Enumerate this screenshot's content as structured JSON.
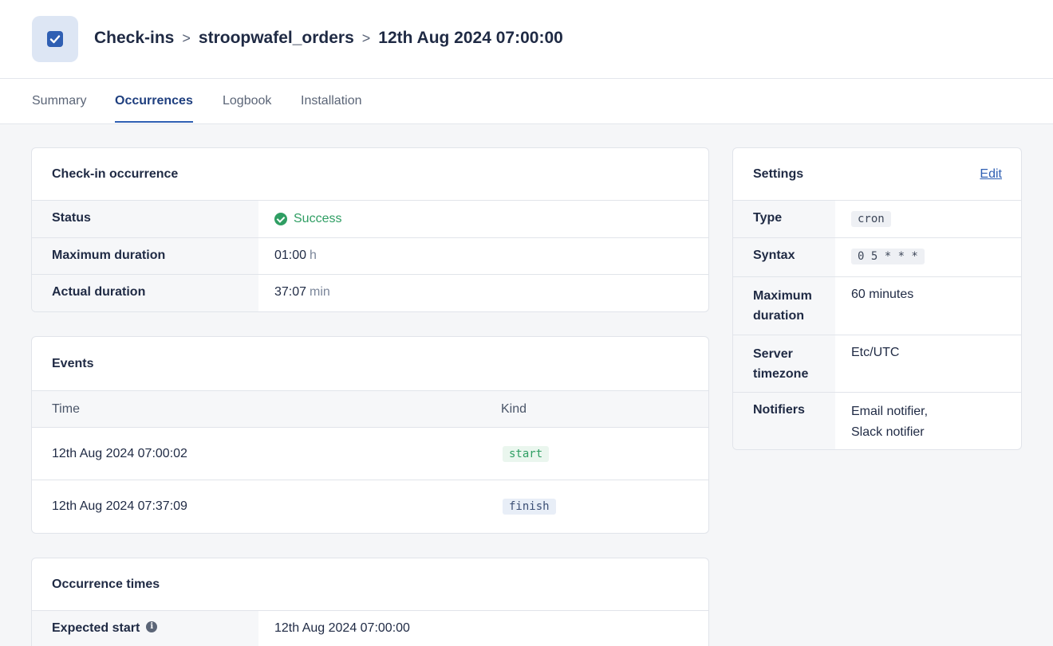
{
  "breadcrumb": {
    "items": [
      "Check-ins",
      "stroopwafel_orders",
      "12th Aug 2024 07:00:00"
    ],
    "separator": ">"
  },
  "tabs": [
    {
      "label": "Summary",
      "active": false
    },
    {
      "label": "Occurrences",
      "active": true
    },
    {
      "label": "Logbook",
      "active": false
    },
    {
      "label": "Installation",
      "active": false
    }
  ],
  "occurrence": {
    "title": "Check-in occurrence",
    "rows": [
      {
        "key": "Status",
        "value": "Success",
        "unit": ""
      },
      {
        "key": "Maximum duration",
        "value": "01:00",
        "unit": "h"
      },
      {
        "key": "Actual duration",
        "value": "37:07",
        "unit": "min"
      }
    ]
  },
  "events": {
    "title": "Events",
    "columns": [
      "Time",
      "Kind"
    ],
    "rows": [
      {
        "time": "12th Aug 2024 07:00:02",
        "kind": "start"
      },
      {
        "time": "12th Aug 2024 07:37:09",
        "kind": "finish"
      }
    ]
  },
  "occurrence_times": {
    "title": "Occurrence times",
    "rows": [
      {
        "key": "Expected start",
        "value": "12th Aug 2024 07:00:00"
      }
    ]
  },
  "settings": {
    "title": "Settings",
    "edit_label": "Edit",
    "rows": [
      {
        "key": "Type",
        "value": "cron"
      },
      {
        "key": "Syntax",
        "value": "0 5 * * *"
      },
      {
        "key": "Maximum duration",
        "value": "60 minutes"
      },
      {
        "key": "Server timezone",
        "value": "Etc/UTC"
      },
      {
        "key": "Notifiers",
        "value": "Email notifier,\nSlack notifier"
      }
    ]
  },
  "colors": {
    "accent": "#2f5fb3",
    "success": "#2f9e63",
    "background": "#f5f6f8"
  },
  "icons": {
    "app": "checkbox-icon",
    "status": "check-circle-icon",
    "info": "info-icon"
  }
}
